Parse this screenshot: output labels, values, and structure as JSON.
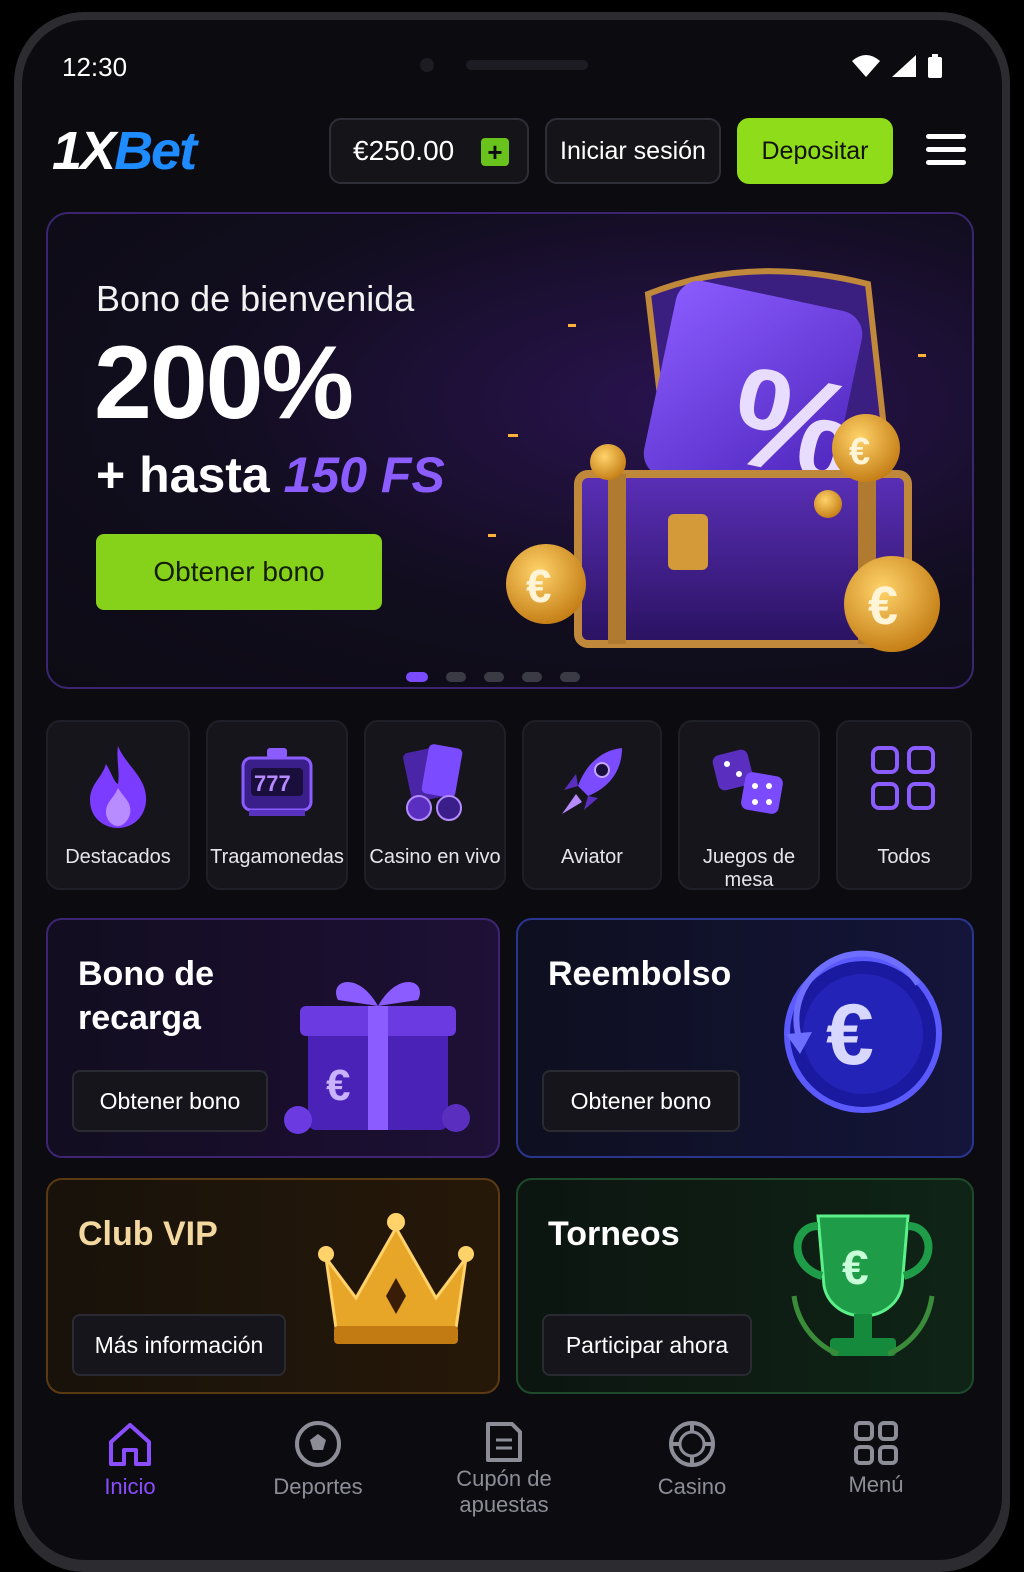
{
  "status_bar": {
    "time": "12:30"
  },
  "header": {
    "logo_prefix": "1X",
    "logo_suffix": "Bet",
    "balance": "€250.00",
    "login_label": "Iniciar sesión",
    "deposit_label": "Depositar"
  },
  "hero": {
    "title": "Bono de bienvenida",
    "percent": "200%",
    "sub_prefix": "+ hasta ",
    "sub_highlight": "150 FS",
    "button_label": "Obtener bono",
    "slide_count": 5,
    "active_slide": 1
  },
  "categories": [
    {
      "label": "Destacados",
      "icon": "fire-icon"
    },
    {
      "label": "Tragamonedas",
      "icon": "slot-machine-icon"
    },
    {
      "label": "Casino en vivo",
      "icon": "cards-chips-icon"
    },
    {
      "label": "Aviator",
      "icon": "rocket-icon"
    },
    {
      "label": "Juegos de mesa",
      "icon": "dice-icon"
    },
    {
      "label": "Todos",
      "icon": "grid-icon"
    }
  ],
  "promos": {
    "reload": {
      "title_line1": "Bono de",
      "title_line2": "recarga",
      "button": "Obtener bono"
    },
    "cashback": {
      "title": "Reembolso",
      "button": "Obtener bono"
    },
    "vip": {
      "title": "Club VIP",
      "button": "Más información"
    },
    "tournaments": {
      "title": "Torneos",
      "button": "Participar ahora"
    }
  },
  "bottom_nav": [
    {
      "label": "Inicio",
      "icon": "home-icon",
      "active": true
    },
    {
      "label": "Deportes",
      "icon": "soccer-ball-icon"
    },
    {
      "label_line1": "Cupón de",
      "label_line2": "apuestas",
      "icon": "coupon-icon"
    },
    {
      "label": "Casino",
      "icon": "chip-icon"
    },
    {
      "label": "Menú",
      "icon": "grid-icon"
    }
  ],
  "colors": {
    "accent_green": "#8fdc1a",
    "accent_purple": "#8a4dff",
    "logo_blue": "#1e8bff",
    "background": "#0c0c10"
  }
}
